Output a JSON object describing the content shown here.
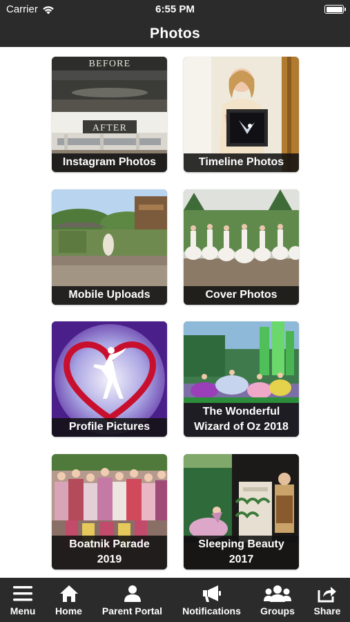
{
  "status_bar": {
    "carrier": "Carrier",
    "time": "6:55 PM"
  },
  "header": {
    "title": "Photos"
  },
  "albums": [
    {
      "lines": [
        "Instagram Photos"
      ]
    },
    {
      "lines": [
        "Timeline Photos"
      ]
    },
    {
      "lines": [
        "Mobile Uploads"
      ]
    },
    {
      "lines": [
        "Cover Photos"
      ]
    },
    {
      "lines": [
        "Profile Pictures"
      ]
    },
    {
      "lines": [
        "The Wonderful",
        "Wizard of Oz 2018"
      ]
    },
    {
      "lines": [
        "Boatnik Parade",
        "2019"
      ]
    },
    {
      "lines": [
        "Sleeping Beauty",
        "2017"
      ]
    }
  ],
  "album_image_text": {
    "before": "BEFORE",
    "after": "AFTER"
  },
  "nav": [
    {
      "label": "Menu",
      "icon": "menu-icon"
    },
    {
      "label": "Home",
      "icon": "home-icon"
    },
    {
      "label": "Parent Portal",
      "icon": "person-icon"
    },
    {
      "label": "Notifications",
      "icon": "megaphone-icon"
    },
    {
      "label": "Groups",
      "icon": "groups-icon"
    },
    {
      "label": "Share",
      "icon": "share-icon"
    }
  ],
  "colors": {
    "bar_background": "#2b2b2b",
    "caption_background": "#121212",
    "text": "#ffffff"
  }
}
